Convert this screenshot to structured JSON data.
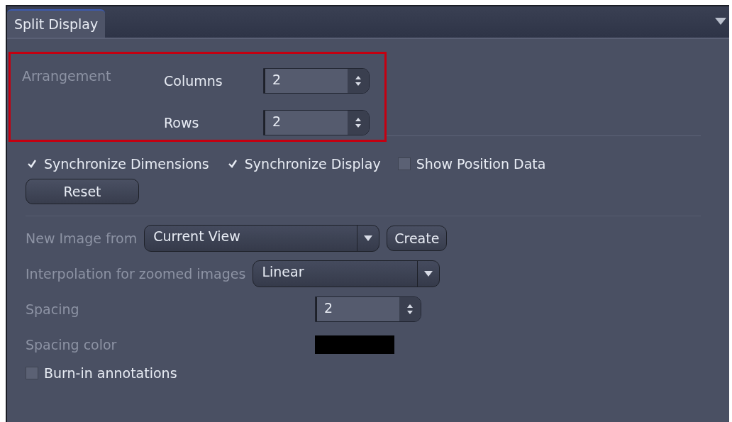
{
  "tabs": [
    {
      "label": "Split Display",
      "selected": true
    }
  ],
  "arrangement": {
    "label": "Arrangement",
    "highlighted": true,
    "fields": [
      {
        "label": "Columns",
        "value": "2"
      },
      {
        "label": "Rows",
        "value": "2"
      }
    ]
  },
  "checkboxes": [
    {
      "label": "Synchronize Dimensions",
      "checked": true
    },
    {
      "label": "Synchronize Display",
      "checked": true
    },
    {
      "label": "Show Position Data",
      "checked": false
    }
  ],
  "reset_button": "Reset",
  "settings": [
    {
      "kind": "dropdown",
      "label": "New Image from",
      "value": "Current View",
      "button": "Create"
    },
    {
      "kind": "dropdown",
      "label": "Interpolation for zoomed images",
      "value": "Linear"
    },
    {
      "kind": "spin",
      "label": "Spacing",
      "value": "2"
    },
    {
      "kind": "color",
      "label": "Spacing color",
      "color": "#000000"
    },
    {
      "kind": "checkbox",
      "label": "Burn-in annotations",
      "checked": false
    }
  ]
}
